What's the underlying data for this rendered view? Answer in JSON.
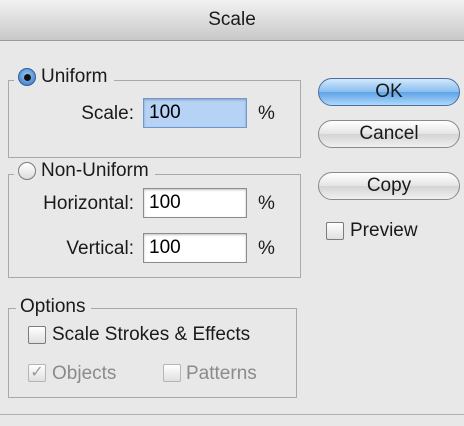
{
  "window": {
    "title": "Scale"
  },
  "uniform": {
    "label": "Uniform",
    "selected": true,
    "scale_label": "Scale:",
    "scale_value": "100",
    "unit": "%"
  },
  "non_uniform": {
    "label": "Non-Uniform",
    "selected": false,
    "horizontal_label": "Horizontal:",
    "horizontal_value": "100",
    "vertical_label": "Vertical:",
    "vertical_value": "100",
    "unit": "%"
  },
  "options": {
    "label": "Options",
    "scale_strokes_label": "Scale Strokes & Effects",
    "scale_strokes_checked": false,
    "objects_label": "Objects",
    "objects_checked": true,
    "patterns_label": "Patterns",
    "patterns_checked": false
  },
  "buttons": {
    "ok": "OK",
    "cancel": "Cancel",
    "copy": "Copy"
  },
  "preview": {
    "label": "Preview",
    "checked": false
  },
  "colors": {
    "default_button": "#5ea3e6",
    "focused_field": "#b6d2f5"
  }
}
